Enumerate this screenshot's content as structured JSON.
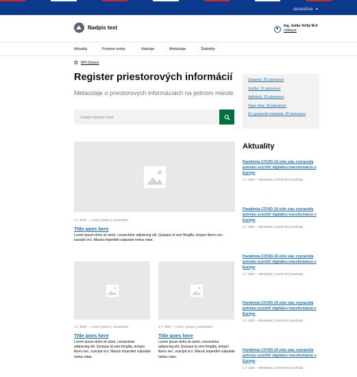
{
  "language": {
    "label": "slovenčina"
  },
  "header": {
    "site_title": "Nadpis text",
    "user_name": "Ing. Jožko Veľký M.A",
    "logout_label": "Odhlásiť"
  },
  "nav": {
    "items": [
      {
        "label": "Aktuality"
      },
      {
        "label": "Povinné osoby"
      },
      {
        "label": "Nástroje"
      },
      {
        "label": "Metaúdaje"
      },
      {
        "label": "Štatistiky"
      }
    ]
  },
  "breadcrumb": {
    "label": "RPI Domov"
  },
  "main": {
    "title": "Register priestorových informácií",
    "subtitle": "Metaúdaje o priestorových informáciách na jednom mieste",
    "search_placeholder": "Zadajte hľadaný výraz"
  },
  "stats": {
    "links": [
      {
        "label": "Datasety: 25 záznamov"
      },
      {
        "label": "Služby: 10 záznamov"
      },
      {
        "label": "Aplikácie: 10 záznamov"
      },
      {
        "label": "Open data: 18 záznamov"
      },
      {
        "label": "EU geoportál metadata: 30 záznamov"
      }
    ]
  },
  "featured": {
    "meta": "1.7. 2020  —  Lorem  |  ipsum  |  consectetur",
    "title": "Title goes here",
    "text": "Lorem ipsum dolor sit amet, consectetur adipiscing elit. Quisque id sem fringilla, tempor libero nec, suscipit orci. Mauris imperdiet vulputate metus vitae."
  },
  "cards": [
    {
      "meta": "1.7. 2020  —  Lorem  |  ipsum  |  consectetur",
      "title": "Title goes here",
      "text": "Lorem ipsum dolor sit amet, consectetur adipiscing elit. Quisque id sem fringilla, tempor libero nec, suscipit orci. Mauris imperdiet vulputate metus vitae."
    },
    {
      "meta": "1.7. 2020  —  Lorem  |  ipsum  |  consectetur",
      "title": "Title goes here",
      "text": "Lorem ipsum dolor sit amet, consectetur adipiscing elit. Quisque id sem fringilla, tempor libero nec, suscipit orci. Mauris imperdiet vulputate metus vitae."
    }
  ],
  "news": {
    "heading": "Aktuality",
    "items": [
      {
        "title": "Pandémia COVID-19 ešte viac zvýraznila potrebu urýchliť digitálnu transformáciu v Európe",
        "meta": "1.7. 2020  —  Ministerka  |  COVID-19  |  Eurofondy"
      },
      {
        "title": "Pandémia COVID-19 ešte viac zvýraznila potrebu urýchliť digitálnu transformáciu v Európe",
        "meta": "1.7. 2020  —  Ministerka  |  COVID-19  |  Eurofondy"
      },
      {
        "title": "Pandémia COVID-19 ešte viac zvýraznila potrebu urýchliť digitálnu transformáciu v Európe",
        "meta": "1.7. 2020  —  Ministerka  |  COVID-19  |  Eurofondy"
      },
      {
        "title": "Pandémia COVID-19 ešte viac zvýraznila potrebu urýchliť digitálnu transformáciu v Európe",
        "meta": "1.7. 2020  —  Ministerka  |  COVID-19  |  Eurofondy"
      },
      {
        "title": "Pandémia COVID-19 ešte viac zvýraznila potrebu urýchliť digitálnu transformáciu v Európe",
        "meta": "1.7. 2020  —  Ministerka  |  COVID-19  |  Eurofondy"
      }
    ]
  },
  "colors": {
    "topbar": "#0b3a8c",
    "link": "#1d70b8",
    "search_button": "#00703c",
    "stripe_red": "#d0282e",
    "stripe_white": "#ffffff"
  },
  "icons": {
    "logo": "logo-triangle-icon",
    "user": "user-icon",
    "home": "home-icon",
    "search": "search-icon",
    "image": "image-placeholder-icon"
  }
}
